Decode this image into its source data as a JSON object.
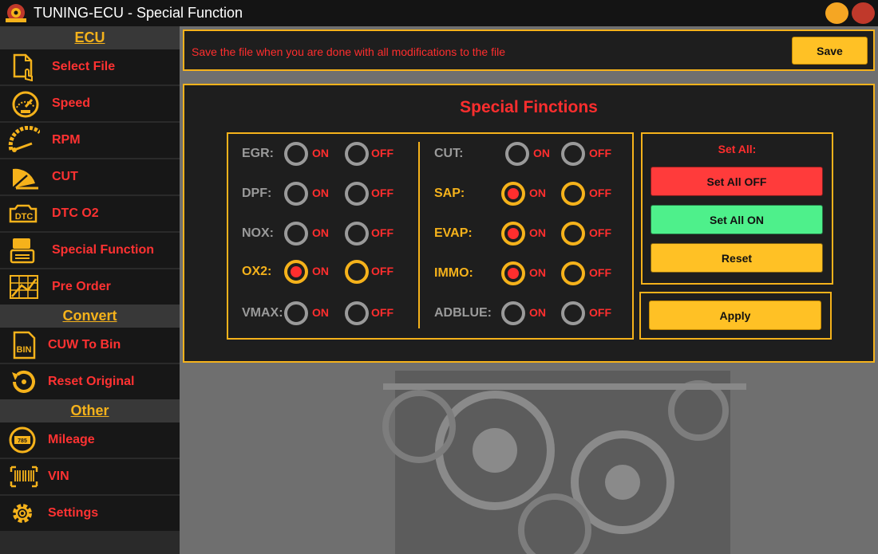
{
  "window": {
    "title": "TUNING-ECU - Special Function",
    "logo_icon": "ecu-logo-icon",
    "minimize_color": "#f5a623",
    "close_color": "#c0392b"
  },
  "sidebar": {
    "sections": [
      {
        "title": "ECU",
        "items": [
          {
            "label": "Select File",
            "icon": "file-select-icon"
          },
          {
            "label": "Speed",
            "icon": "speedometer-icon"
          },
          {
            "label": "RPM",
            "icon": "rpm-gauge-icon"
          },
          {
            "label": "CUT",
            "icon": "cut-gauge-icon"
          },
          {
            "label": "DTC O2",
            "icon": "dtc-engine-icon"
          },
          {
            "label": "Special Function",
            "icon": "special-function-icon"
          },
          {
            "label": "Pre Order",
            "icon": "pre-order-icon"
          }
        ]
      },
      {
        "title": "Convert",
        "items": [
          {
            "label": "CUW To Bin",
            "icon": "bin-file-icon"
          },
          {
            "label": "Reset Original",
            "icon": "reset-icon"
          }
        ]
      },
      {
        "title": "Other",
        "items": [
          {
            "label": "Mileage",
            "icon": "odometer-icon"
          },
          {
            "label": "VIN",
            "icon": "barcode-icon"
          },
          {
            "label": "Settings",
            "icon": "gear-icon"
          }
        ]
      }
    ]
  },
  "save_panel": {
    "message": "Save the file when you are done with all modifications to the file",
    "save_label": "Save"
  },
  "main": {
    "title": "Special Finctions",
    "option_on": "ON",
    "option_off": "OFF",
    "left_functions": [
      {
        "label": "EGR:",
        "state": "none"
      },
      {
        "label": "DPF:",
        "state": "none"
      },
      {
        "label": "NOX:",
        "state": "none"
      },
      {
        "label": "OX2:",
        "state": "on"
      },
      {
        "label": "VMAX:",
        "state": "none"
      }
    ],
    "right_functions": [
      {
        "label": "CUT:",
        "state": "none"
      },
      {
        "label": "SAP:",
        "state": "on"
      },
      {
        "label": "EVAP:",
        "state": "on"
      },
      {
        "label": "IMMO:",
        "state": "on"
      },
      {
        "label": "ADBLUE:",
        "state": "none"
      }
    ],
    "set_all": {
      "title": "Set All:",
      "off_label": "Set All OFF",
      "on_label": "Set All ON",
      "reset_label": "Reset"
    },
    "apply_label": "Apply"
  },
  "colors": {
    "accent": "#f5b21b",
    "label_red": "#ff2e2e",
    "inactive_gray": "#9a9a9a",
    "set_off": "#ff3b3b",
    "set_on": "#4ef08b",
    "yellow_button": "#ffc125"
  }
}
